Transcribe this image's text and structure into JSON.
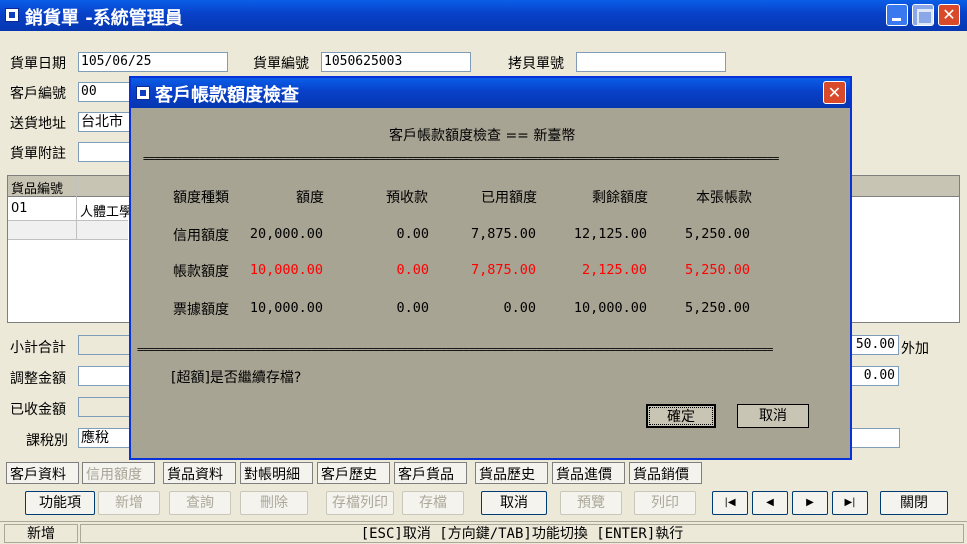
{
  "window": {
    "title": "銷貨單 -系統管理員",
    "close_glyph": "✕"
  },
  "form": {
    "date_label": "貨單日期",
    "date_value": "105/06/25",
    "order_no_label": "貨單編號",
    "order_no_value": "1050625003",
    "copy_no_label": "拷貝單號",
    "copy_no_value": "",
    "customer_label": "客戶編號",
    "customer_value": "00",
    "address_label": "送貨地址",
    "address_value": "台北市",
    "note_label": "貨單附註",
    "note_value": ""
  },
  "grid": {
    "header": "貨品編號",
    "row1_code": "01",
    "row1_name": "人體工學"
  },
  "totals": {
    "subtotal_label": "小計合計",
    "subtotal_right": "50.00",
    "extra_label": "外加",
    "adjust_label": "調整金額",
    "adjust_right": "0.00",
    "received_label": "已收金額",
    "tax_label": "課稅別",
    "tax_value": "應稅"
  },
  "tabs": [
    "客戶資料",
    "信用額度",
    "貨品資料",
    "對帳明細",
    "客戶歷史",
    "客戶貨品",
    "貨品歷史",
    "貨品進價",
    "貨品銷價"
  ],
  "buttons": {
    "function": "功能項",
    "add": "新增",
    "query": "查詢",
    "delete": "刪除",
    "save_print": "存檔列印",
    "save": "存檔",
    "cancel": "取消",
    "preview": "預覽",
    "print": "列印",
    "close": "關閉"
  },
  "nav_icons": [
    "first-record-icon",
    "prev-record-icon",
    "next-record-icon",
    "last-record-icon"
  ],
  "status": {
    "mode": "新增",
    "hint": "[ESC]取消 [方向鍵/TAB]功能切換 [ENTER]執行"
  },
  "dialog": {
    "title": "客戶帳款額度檢查",
    "heading": "客戶帳款額度檢查 == 新臺幣",
    "separator": "=================================================================================================================",
    "columns": [
      "額度種類",
      "額度",
      "預收款",
      "已用額度",
      "剩餘額度",
      "本張帳款"
    ],
    "rows": [
      {
        "type": "信用額度",
        "limit": "20,000.00",
        "prepaid": "0.00",
        "used": "7,875.00",
        "remaining": "12,125.00",
        "current": "5,250.00"
      },
      {
        "type": "帳款額度",
        "limit": "10,000.00",
        "prepaid": "0.00",
        "used": "7,875.00",
        "remaining": "2,125.00",
        "current": "5,250.00"
      },
      {
        "type": "票據額度",
        "limit": "10,000.00",
        "prepaid": "0.00",
        "used": "0.00",
        "remaining": "10,000.00",
        "current": "5,250.00"
      }
    ],
    "question": "[超額]是否繼續存檔?",
    "ok": "確定",
    "cancel": "取消",
    "close_glyph": "✕"
  },
  "colors": {
    "title_blue": "#0840c8",
    "dialog_bg": "#a8a494",
    "warn_red": "#ff0000",
    "window_bg": "#ece9d8"
  }
}
